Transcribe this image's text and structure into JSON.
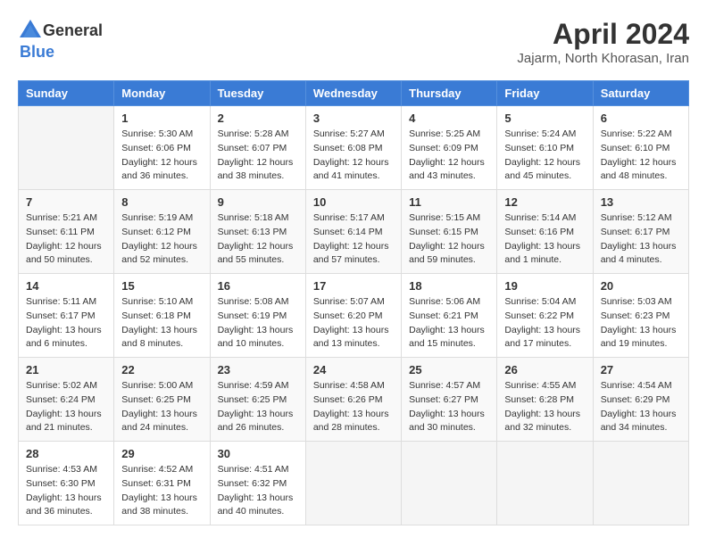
{
  "header": {
    "logo_general": "General",
    "logo_blue": "Blue",
    "month_title": "April 2024",
    "location": "Jajarm, North Khorasan, Iran"
  },
  "days_of_week": [
    "Sunday",
    "Monday",
    "Tuesday",
    "Wednesday",
    "Thursday",
    "Friday",
    "Saturday"
  ],
  "weeks": [
    [
      {
        "day": "",
        "info": ""
      },
      {
        "day": "1",
        "info": "Sunrise: 5:30 AM\nSunset: 6:06 PM\nDaylight: 12 hours\nand 36 minutes."
      },
      {
        "day": "2",
        "info": "Sunrise: 5:28 AM\nSunset: 6:07 PM\nDaylight: 12 hours\nand 38 minutes."
      },
      {
        "day": "3",
        "info": "Sunrise: 5:27 AM\nSunset: 6:08 PM\nDaylight: 12 hours\nand 41 minutes."
      },
      {
        "day": "4",
        "info": "Sunrise: 5:25 AM\nSunset: 6:09 PM\nDaylight: 12 hours\nand 43 minutes."
      },
      {
        "day": "5",
        "info": "Sunrise: 5:24 AM\nSunset: 6:10 PM\nDaylight: 12 hours\nand 45 minutes."
      },
      {
        "day": "6",
        "info": "Sunrise: 5:22 AM\nSunset: 6:10 PM\nDaylight: 12 hours\nand 48 minutes."
      }
    ],
    [
      {
        "day": "7",
        "info": "Sunrise: 5:21 AM\nSunset: 6:11 PM\nDaylight: 12 hours\nand 50 minutes."
      },
      {
        "day": "8",
        "info": "Sunrise: 5:19 AM\nSunset: 6:12 PM\nDaylight: 12 hours\nand 52 minutes."
      },
      {
        "day": "9",
        "info": "Sunrise: 5:18 AM\nSunset: 6:13 PM\nDaylight: 12 hours\nand 55 minutes."
      },
      {
        "day": "10",
        "info": "Sunrise: 5:17 AM\nSunset: 6:14 PM\nDaylight: 12 hours\nand 57 minutes."
      },
      {
        "day": "11",
        "info": "Sunrise: 5:15 AM\nSunset: 6:15 PM\nDaylight: 12 hours\nand 59 minutes."
      },
      {
        "day": "12",
        "info": "Sunrise: 5:14 AM\nSunset: 6:16 PM\nDaylight: 13 hours\nand 1 minute."
      },
      {
        "day": "13",
        "info": "Sunrise: 5:12 AM\nSunset: 6:17 PM\nDaylight: 13 hours\nand 4 minutes."
      }
    ],
    [
      {
        "day": "14",
        "info": "Sunrise: 5:11 AM\nSunset: 6:17 PM\nDaylight: 13 hours\nand 6 minutes."
      },
      {
        "day": "15",
        "info": "Sunrise: 5:10 AM\nSunset: 6:18 PM\nDaylight: 13 hours\nand 8 minutes."
      },
      {
        "day": "16",
        "info": "Sunrise: 5:08 AM\nSunset: 6:19 PM\nDaylight: 13 hours\nand 10 minutes."
      },
      {
        "day": "17",
        "info": "Sunrise: 5:07 AM\nSunset: 6:20 PM\nDaylight: 13 hours\nand 13 minutes."
      },
      {
        "day": "18",
        "info": "Sunrise: 5:06 AM\nSunset: 6:21 PM\nDaylight: 13 hours\nand 15 minutes."
      },
      {
        "day": "19",
        "info": "Sunrise: 5:04 AM\nSunset: 6:22 PM\nDaylight: 13 hours\nand 17 minutes."
      },
      {
        "day": "20",
        "info": "Sunrise: 5:03 AM\nSunset: 6:23 PM\nDaylight: 13 hours\nand 19 minutes."
      }
    ],
    [
      {
        "day": "21",
        "info": "Sunrise: 5:02 AM\nSunset: 6:24 PM\nDaylight: 13 hours\nand 21 minutes."
      },
      {
        "day": "22",
        "info": "Sunrise: 5:00 AM\nSunset: 6:25 PM\nDaylight: 13 hours\nand 24 minutes."
      },
      {
        "day": "23",
        "info": "Sunrise: 4:59 AM\nSunset: 6:25 PM\nDaylight: 13 hours\nand 26 minutes."
      },
      {
        "day": "24",
        "info": "Sunrise: 4:58 AM\nSunset: 6:26 PM\nDaylight: 13 hours\nand 28 minutes."
      },
      {
        "day": "25",
        "info": "Sunrise: 4:57 AM\nSunset: 6:27 PM\nDaylight: 13 hours\nand 30 minutes."
      },
      {
        "day": "26",
        "info": "Sunrise: 4:55 AM\nSunset: 6:28 PM\nDaylight: 13 hours\nand 32 minutes."
      },
      {
        "day": "27",
        "info": "Sunrise: 4:54 AM\nSunset: 6:29 PM\nDaylight: 13 hours\nand 34 minutes."
      }
    ],
    [
      {
        "day": "28",
        "info": "Sunrise: 4:53 AM\nSunset: 6:30 PM\nDaylight: 13 hours\nand 36 minutes."
      },
      {
        "day": "29",
        "info": "Sunrise: 4:52 AM\nSunset: 6:31 PM\nDaylight: 13 hours\nand 38 minutes."
      },
      {
        "day": "30",
        "info": "Sunrise: 4:51 AM\nSunset: 6:32 PM\nDaylight: 13 hours\nand 40 minutes."
      },
      {
        "day": "",
        "info": ""
      },
      {
        "day": "",
        "info": ""
      },
      {
        "day": "",
        "info": ""
      },
      {
        "day": "",
        "info": ""
      }
    ]
  ]
}
